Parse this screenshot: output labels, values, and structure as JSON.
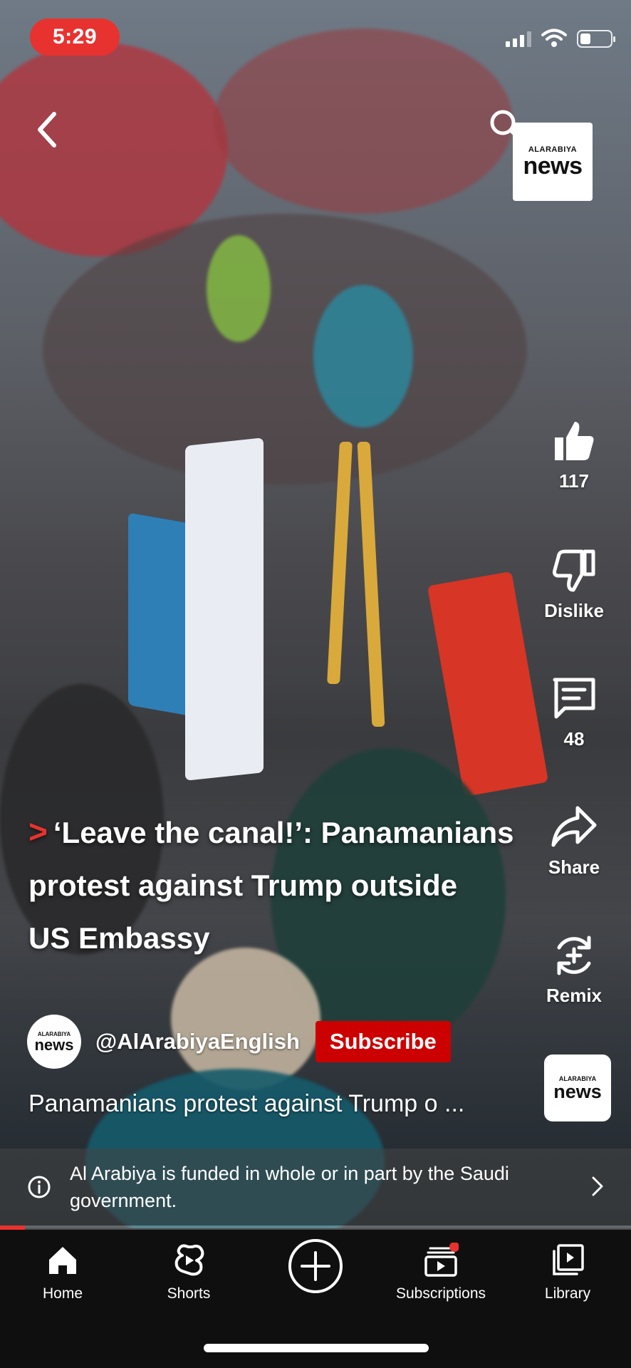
{
  "status_bar": {
    "time": "5:29"
  },
  "header": {
    "back_icon": "chevron-left-icon",
    "search_icon": "search-icon",
    "logo": {
      "small": "ALARABIYA",
      "big": "news"
    }
  },
  "actions": {
    "like_count": "117",
    "dislike_label": "Dislike",
    "comment_count": "48",
    "share_label": "Share",
    "remix_label": "Remix"
  },
  "video": {
    "headline_line1": "‘Leave the canal!’: Panamanians",
    "headline_line2": "protest against Trump outside",
    "headline_line3": "US Embassy",
    "channel_handle": "@AlArabiyaEnglish",
    "subscribe_label": "Subscribe",
    "description": "Panamanians protest against Trump o ...",
    "channel_logo": {
      "small": "ALARABIYA",
      "big": "news"
    },
    "progress": 0.04
  },
  "funding_notice": {
    "text": "Al Arabiya is funded in whole or in part by the Saudi government."
  },
  "nav": {
    "home": "Home",
    "shorts": "Shorts",
    "subscriptions": "Subscriptions",
    "library": "Library"
  },
  "colors": {
    "accent_red": "#e8322f",
    "subscribe_red": "#cc0000",
    "nav_bg": "#0f0f0f"
  }
}
